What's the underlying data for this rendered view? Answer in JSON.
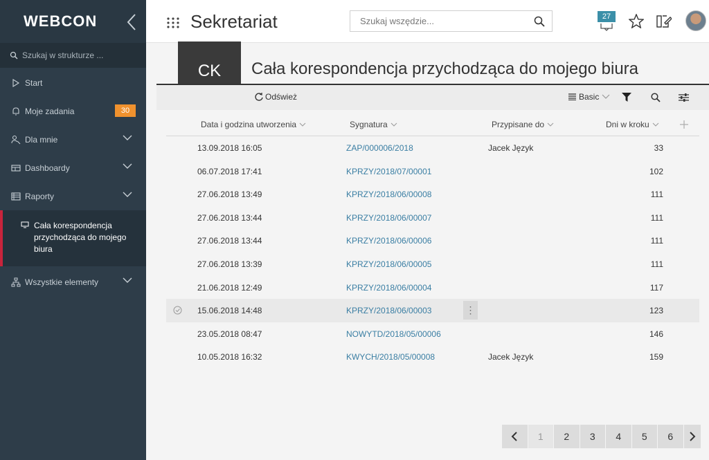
{
  "sidebar": {
    "logo": "WEBCON",
    "search_placeholder": "Szukaj w strukturze ...",
    "items": [
      {
        "label": "Start",
        "icon": "play-icon"
      },
      {
        "label": "Moje zadania",
        "icon": "bell-icon",
        "badge": "30"
      },
      {
        "label": "Dla mnie",
        "icon": "user-key-icon"
      },
      {
        "label": "Dashboardy",
        "icon": "dashboard-icon"
      },
      {
        "label": "Raporty",
        "icon": "report-icon"
      }
    ],
    "active_item": {
      "label": "Cała korespondencja przychodząca do mojego biura",
      "icon": "monitor-icon"
    },
    "last_item": {
      "label": "Wszystkie elementy",
      "icon": "sitemap-icon"
    }
  },
  "header": {
    "title": "Sekretariat",
    "search_placeholder": "Szukaj wszędzie...",
    "notifications_count": "27"
  },
  "page": {
    "tile": "CK",
    "title": "Cała korespondencja przychodząca do mojego biura",
    "refresh_label": "Odśwież",
    "view_label": "Basic"
  },
  "table": {
    "columns": [
      "Data i godzina utworzenia",
      "Sygnatura",
      "Przypisane do",
      "Dni w kroku"
    ],
    "rows": [
      {
        "date": "13.09.2018 16:05",
        "sig": "ZAP/000006/2018",
        "assigned": "Jacek Język",
        "days": "33"
      },
      {
        "date": "06.07.2018 17:41",
        "sig": "KPRZY/2018/07/00001",
        "assigned": "",
        "days": "102"
      },
      {
        "date": "27.06.2018 13:49",
        "sig": "KPRZY/2018/06/00008",
        "assigned": "",
        "days": "111"
      },
      {
        "date": "27.06.2018 13:44",
        "sig": "KPRZY/2018/06/00007",
        "assigned": "",
        "days": "111"
      },
      {
        "date": "27.06.2018 13:44",
        "sig": "KPRZY/2018/06/00006",
        "assigned": "",
        "days": "111"
      },
      {
        "date": "27.06.2018 13:39",
        "sig": "KPRZY/2018/06/00005",
        "assigned": "",
        "days": "111"
      },
      {
        "date": "21.06.2018 12:49",
        "sig": "KPRZY/2018/06/00004",
        "assigned": "",
        "days": "117"
      },
      {
        "date": "15.06.2018 14:48",
        "sig": "KPRZY/2018/06/00003",
        "assigned": "",
        "days": "123"
      },
      {
        "date": "23.05.2018 08:47",
        "sig": "NOWYTD/2018/05/00006",
        "assigned": "",
        "days": "146"
      },
      {
        "date": "10.05.2018 16:32",
        "sig": "KWYCH/2018/05/00008",
        "assigned": "Jacek Język",
        "days": "159"
      }
    ]
  },
  "pagination": {
    "pages": [
      "1",
      "2",
      "3",
      "4",
      "5",
      "6"
    ],
    "current": "1"
  },
  "colors": {
    "sidebar_bg": "#2e3d49",
    "accent_red": "#c8243c",
    "badge_orange": "#f0922e",
    "link_blue": "#3a7ea3",
    "notif_teal": "#3b8fa8"
  }
}
